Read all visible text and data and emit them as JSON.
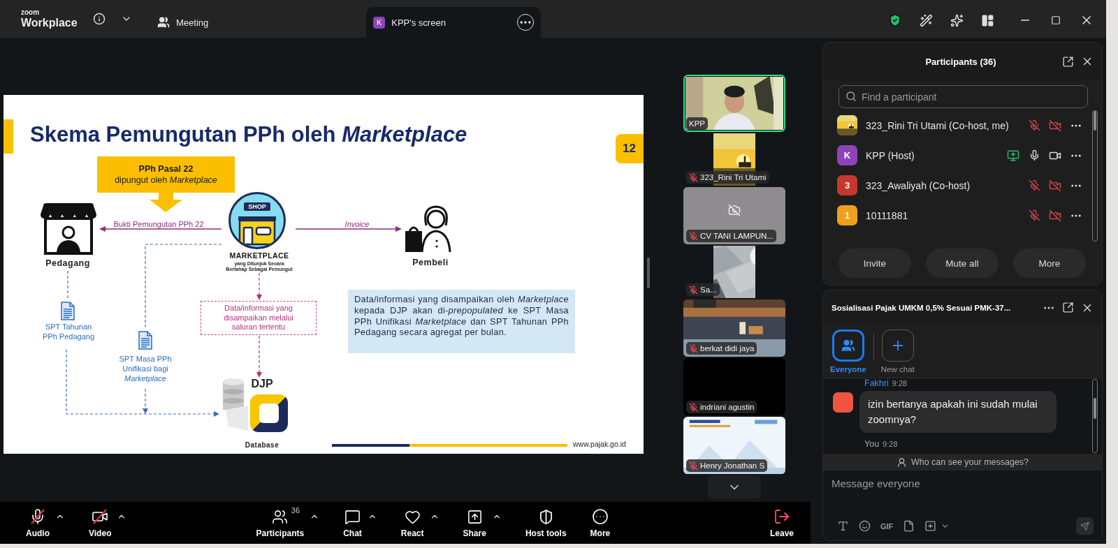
{
  "titlebar": {
    "logo_small": "zoom",
    "logo_main": "Workplace",
    "tabs": [
      {
        "label": "Meeting",
        "kind": "meeting",
        "selected": false
      },
      {
        "label": "KPP's screen",
        "kind": "share",
        "avatar": "K",
        "color": "#8e44b8",
        "selected": true
      }
    ]
  },
  "slide": {
    "title": "Skema Pemungutan PPh oleh *Marketplace*",
    "page": "12",
    "callout": {
      "title": "PPh Pasal 22",
      "text": "dipungut oleh *Marketplace*"
    },
    "receipt_label": "Bukti Pemungutan PPh 22",
    "invoice_label": "Invoice",
    "seller": "Pedagang",
    "shop_sign": "SHOP",
    "marketplace": "MARKETPLACE",
    "marketplace_note": "yang Ditunjuk Secara Bertahap Sebagai Pemungut",
    "buyer": "Pembeli",
    "annual_return": "SPT Tahunan PPh Pedagang",
    "periodic_return": "SPT Masa PPh Unifikasi bagi *Marketplace*",
    "data_channel": "Data/informasi yang disampaikan melalui saluran tertentu",
    "database_owner": "DJP",
    "database_label": "Database",
    "info_text": "Data/informasi yang disampaikan oleh *Marketplace* kepada DJP akan di-*prepopulated* ke SPT Masa PPh Unifikasi *Marketplace* dan SPT Tahunan PPh Pedagang secara agregat per bulan.",
    "website": "www.pajak.go.id"
  },
  "gallery": {
    "tiles": [
      {
        "name": "KPP",
        "kind": "video",
        "muted": false,
        "speaking": true
      },
      {
        "name": "323_Rini Tri Utami",
        "kind": "thumb",
        "muted": true,
        "speaking": false
      },
      {
        "name": "CV TANI LAMPUN...",
        "kind": "off",
        "muted": true,
        "speaking": false
      },
      {
        "name": "Sa...",
        "kind": "thumb",
        "muted": true,
        "speaking": false
      },
      {
        "name": "berkat didi jaya",
        "kind": "video",
        "muted": true,
        "speaking": false
      },
      {
        "name": "indriani agustin",
        "kind": "blank",
        "muted": true,
        "speaking": false
      },
      {
        "name": "Henry Jonathan S",
        "kind": "video",
        "muted": true,
        "speaking": false
      }
    ]
  },
  "participants": {
    "title": "Participants (36)",
    "search": {
      "placeholder": "Find a participant"
    },
    "rows": [
      {
        "name": "323_Rini Tri Utami (Co-host, me)",
        "sharing": false,
        "audio_muted": true,
        "video_off": true
      },
      {
        "name": "KPP (Host)",
        "avatar": {
          "kind": "letter",
          "letter": "K",
          "color": "#8e44b8"
        },
        "sharing": true,
        "audio_muted": false,
        "video_off": false
      },
      {
        "name": "323_Awaliyah (Co-host)",
        "avatar": {
          "kind": "letter",
          "letter": "3",
          "color": "#c8372d"
        },
        "sharing": false,
        "audio_muted": true,
        "video_off": true
      },
      {
        "name": "10111881",
        "avatar": {
          "kind": "letter",
          "letter": "1",
          "color": "#f0a01c"
        },
        "sharing": false,
        "audio_muted": true,
        "video_off": true
      }
    ],
    "buttons": [
      "Invite",
      "Mute all",
      "More"
    ]
  },
  "chat": {
    "title": "Sosialisasi Pajak UMKM 0,5% Sesuai PMK-37...",
    "tabs": [
      {
        "label": "Everyone",
        "kind": "everyone",
        "selected": true
      },
      {
        "label": "New chat",
        "kind": "new",
        "selected": false
      }
    ],
    "messages": [
      {
        "sender": "Fakhri",
        "time": "9:28",
        "text": "izin bertanya apakah ini sudah mulai zoomnya?",
        "self": false,
        "color": "#ef5443"
      },
      {
        "sender": "You",
        "time": "9:28",
        "self": true
      }
    ],
    "visibility_note": "Who can see your messages?",
    "composer": {
      "placeholder": "Message everyone",
      "gif_label": "GIF"
    }
  },
  "toolbar": {
    "left": [
      {
        "kind": "audio",
        "label": "Audio",
        "muted": true,
        "caret": true
      },
      {
        "kind": "video",
        "label": "Video",
        "muted": true,
        "caret": true
      }
    ],
    "center": [
      {
        "kind": "participants",
        "label": "Participants",
        "count": "36",
        "caret": true
      },
      {
        "kind": "chat",
        "label": "Chat",
        "caret": true
      },
      {
        "kind": "react",
        "label": "React",
        "caret": true
      },
      {
        "kind": "share",
        "label": "Share",
        "caret": true
      },
      {
        "kind": "host",
        "label": "Host tools",
        "caret": false
      },
      {
        "kind": "more",
        "label": "More",
        "caret": false
      }
    ],
    "right": [
      {
        "kind": "leave",
        "label": "Leave",
        "caret": false
      }
    ]
  }
}
